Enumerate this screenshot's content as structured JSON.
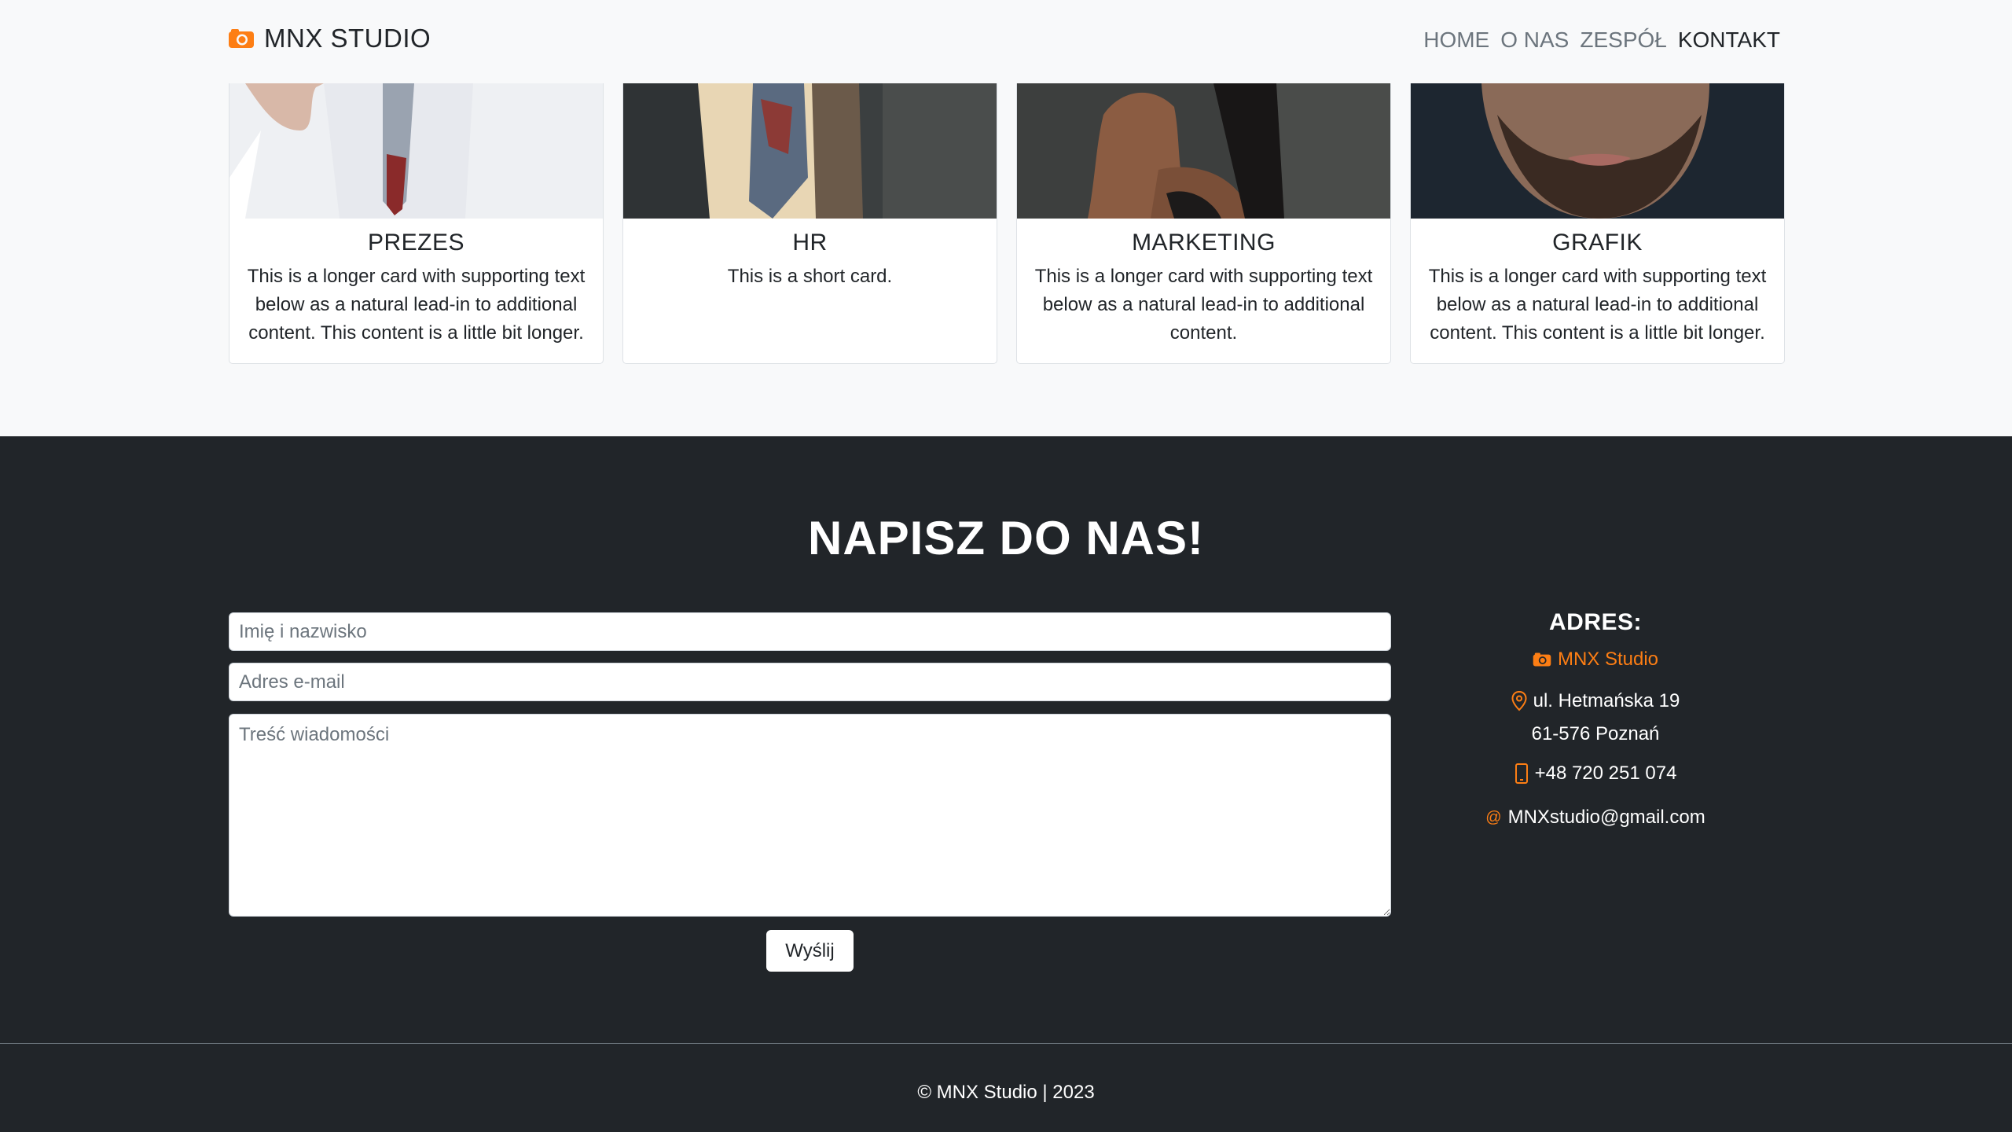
{
  "navbar": {
    "brand": "MNX STUDIO",
    "links": [
      "HOME",
      "O NAS",
      "ZESPÓŁ",
      "KONTAKT"
    ],
    "active_link": "KONTAKT"
  },
  "team": [
    {
      "title": "PREZES",
      "text": "This is a longer card with supporting text below as a natural lead-in to additional content. This content is a little bit longer."
    },
    {
      "title": "HR",
      "text": "This is a short card."
    },
    {
      "title": "MARKETING",
      "text": "This is a longer card with supporting text below as a natural lead-in to additional content."
    },
    {
      "title": "GRAFIK",
      "text": "This is a longer card with supporting text below as a natural lead-in to additional content. This content is a little bit longer."
    }
  ],
  "contact": {
    "title": "NAPISZ DO NAS!",
    "name_placeholder": "Imię i nazwisko",
    "email_placeholder": "Adres e-mail",
    "message_placeholder": "Treść wiadomości",
    "send_label": "Wyślij"
  },
  "address": {
    "title": "ADRES:",
    "brand": "MNX Studio",
    "street": "ul. Hetmańska 19",
    "city": "61-576 Poznań",
    "phone": "+48 720 251 074",
    "email": "MNXstudio@gmail.com"
  },
  "footer": {
    "copyright": "© MNX Studio | 2023"
  },
  "colors": {
    "accent": "#fd7e14",
    "dark": "#212529",
    "light": "#f8f9fa"
  },
  "icons": [
    "camera-icon",
    "map-pin-icon",
    "phone-icon",
    "at-sign-icon"
  ]
}
